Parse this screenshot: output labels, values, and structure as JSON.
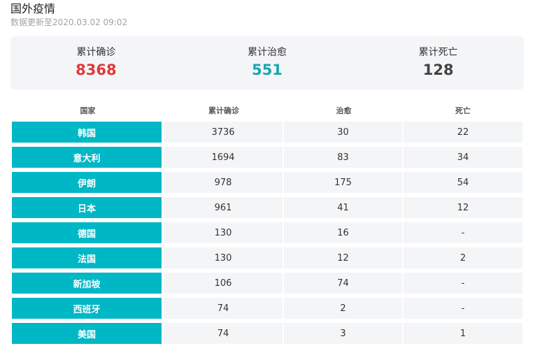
{
  "header": {
    "title": "国外疫情",
    "update_text": "数据更新至2020.03.02 09:02"
  },
  "summary": {
    "confirmed": {
      "label": "累计确诊",
      "value": "8368",
      "color": "#e0393e"
    },
    "cured": {
      "label": "累计治愈",
      "value": "551",
      "color": "#1ba6b0"
    },
    "dead": {
      "label": "累计死亡",
      "value": "128",
      "color": "#444444"
    }
  },
  "table": {
    "columns": [
      "国家",
      "累计确诊",
      "治愈",
      "死亡"
    ],
    "rows": [
      [
        "韩国",
        "3736",
        "30",
        "22"
      ],
      [
        "意大利",
        "1694",
        "83",
        "34"
      ],
      [
        "伊朗",
        "978",
        "175",
        "54"
      ],
      [
        "日本",
        "961",
        "41",
        "12"
      ],
      [
        "德国",
        "130",
        "16",
        "-"
      ],
      [
        "法国",
        "130",
        "12",
        "2"
      ],
      [
        "新加坡",
        "106",
        "74",
        "-"
      ],
      [
        "西班牙",
        "74",
        "2",
        "-"
      ],
      [
        "美国",
        "74",
        "3",
        "1"
      ]
    ]
  },
  "colors": {
    "country_cell": "#00b7c5",
    "row_background": "#f4f5f7"
  }
}
